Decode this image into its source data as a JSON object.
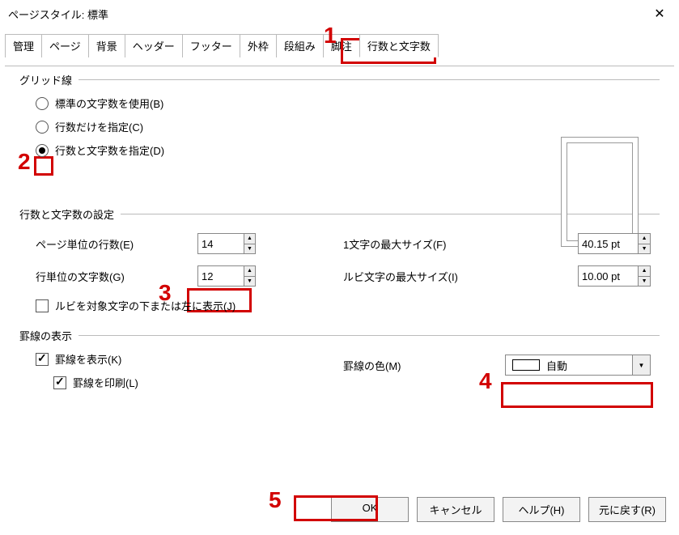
{
  "window": {
    "title": "ページスタイル: 標準"
  },
  "tabs": {
    "items": [
      {
        "label": "管理"
      },
      {
        "label": "ページ"
      },
      {
        "label": "背景"
      },
      {
        "label": "ヘッダー"
      },
      {
        "label": "フッター"
      },
      {
        "label": "外枠"
      },
      {
        "label": "段組み"
      },
      {
        "label": "脚注"
      },
      {
        "label": "行数と文字数",
        "active": true
      }
    ]
  },
  "grid_group": {
    "title": "グリッド線",
    "radio_standard": "標準の文字数を使用(B)",
    "radio_lines_only": "行数だけを指定(C)",
    "radio_lines_chars": "行数と文字数を指定(D)"
  },
  "settings_group": {
    "title": "行数と文字数の設定",
    "lines_per_page_label": "ページ単位の行数(E)",
    "lines_per_page_value": "14",
    "chars_per_line_label": "行単位の文字数(G)",
    "chars_per_line_value": "12",
    "max_char_size_label": "1文字の最大サイズ(F)",
    "max_char_size_value": "40.15 pt",
    "ruby_max_size_label": "ルビ文字の最大サイズ(I)",
    "ruby_max_size_value": "10.00 pt",
    "ruby_below_left_label": "ルビを対象文字の下または左に表示(J)"
  },
  "ruled_group": {
    "title": "罫線の表示",
    "show_ruled_label": "罫線を表示(K)",
    "print_ruled_label": "罫線を印刷(L)",
    "ruled_color_label": "罫線の色(M)",
    "ruled_color_value": "自動"
  },
  "buttons": {
    "ok": "OK",
    "cancel": "キャンセル",
    "help": "ヘルプ(H)",
    "reset": "元に戻す(R)"
  },
  "annotations": {
    "n1": "1",
    "n2": "2",
    "n3": "3",
    "n4": "4",
    "n5": "5"
  }
}
